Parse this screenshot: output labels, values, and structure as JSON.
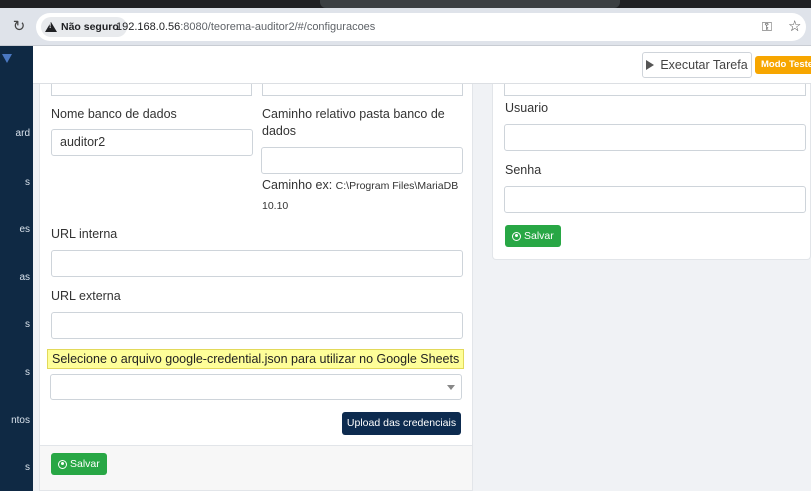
{
  "browser": {
    "security_label": "Não seguro",
    "url_host": "192.168.0.56",
    "url_rest": ":8080/teorema-auditor2/#/configuracoes"
  },
  "sidebar": {
    "items": [
      "ard",
      "s",
      "es",
      "as",
      "s",
      "s",
      "ntos",
      "s"
    ]
  },
  "header": {
    "execute_label": "Executar Tarefa",
    "mode_badge": "Modo Teste"
  },
  "db_form": {
    "db_name_label": "Nome banco de dados",
    "db_name_value": "auditor2",
    "db_path_label": "Caminho relativo pasta banco de dados",
    "db_path_value": "",
    "db_path_hint_prefix": "Caminho ex:",
    "db_path_hint_example": "C:\\Program Files\\MariaDB 10.10",
    "internal_url_label": "URL interna",
    "internal_url_value": "",
    "external_url_label": "URL externa",
    "external_url_value": "",
    "credential_prompt": "Selecione o arquivo google-credential.json para utilizar no Google Sheets",
    "credential_select_value": "",
    "upload_label": "Upload das credenciais",
    "save_label": "Salvar"
  },
  "auth_form": {
    "user_label": "Usuario",
    "user_value": "",
    "password_label": "Senha",
    "password_value": "",
    "save_label": "Salvar"
  },
  "colors": {
    "sidebar_bg": "#0f2944",
    "save_green": "#28a745",
    "upload_navy": "#0d2b4f",
    "badge_orange": "#f7a600",
    "highlight_yellow": "#fefe99"
  }
}
